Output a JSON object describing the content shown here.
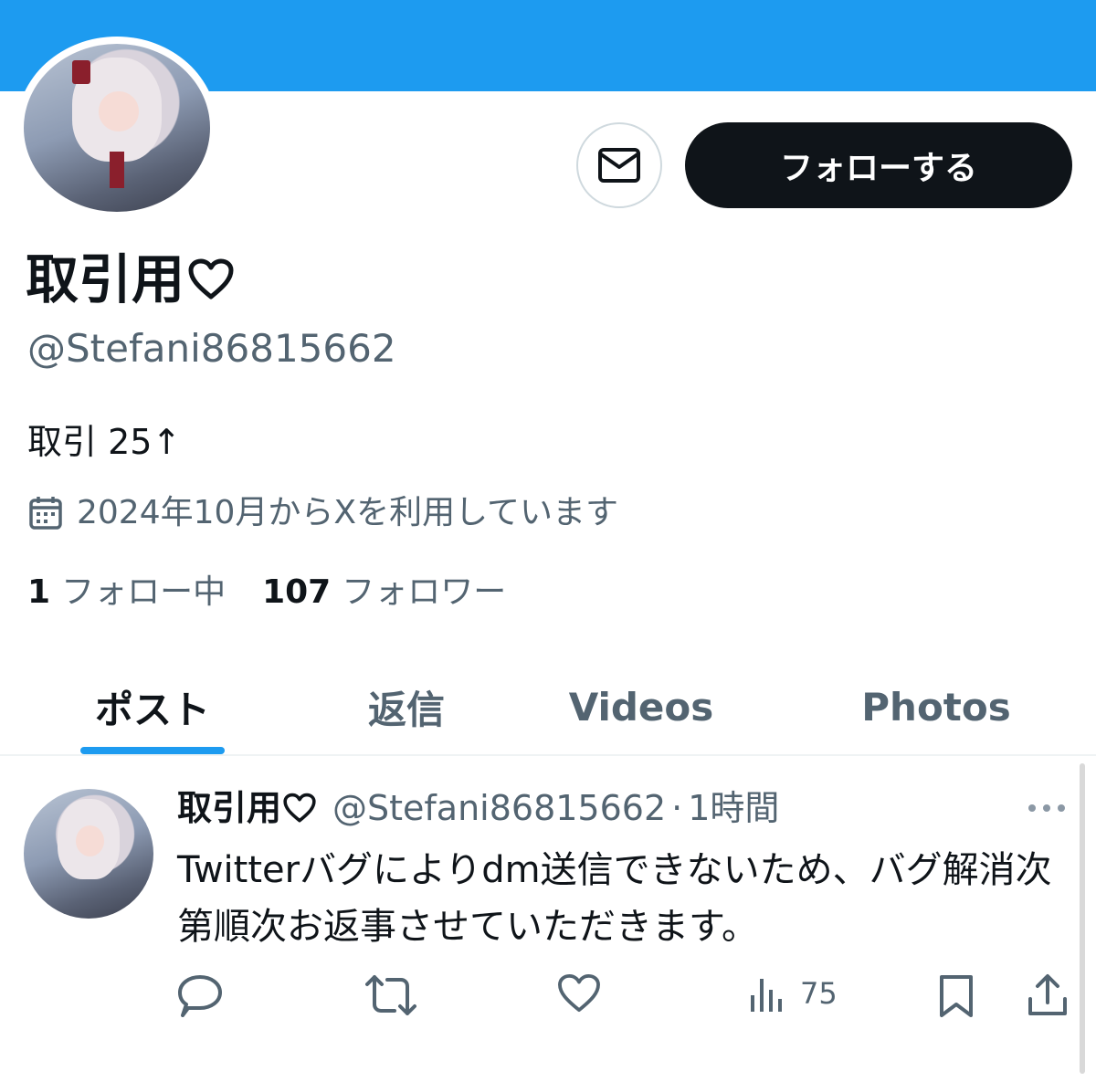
{
  "profile": {
    "display_name": "取引用",
    "handle": "@Stefani86815662",
    "bio": "取引 25↑",
    "joined": "2024年10月からXを利用しています",
    "following_count": "1",
    "following_label": "フォロー中",
    "followers_count": "107",
    "followers_label": "フォロワー",
    "follow_label": "フォローする"
  },
  "tabs": [
    {
      "label": "ポスト"
    },
    {
      "label": "返信"
    },
    {
      "label": "Videos"
    },
    {
      "label": "Photos"
    }
  ],
  "post": {
    "name": "取引用",
    "handle": "@Stefani86815662",
    "separator": "·",
    "time": "1時間",
    "text": "Twitterバグによりdm送信できないため、バグ解消次第順次お返事させていただきます。",
    "views": "75"
  },
  "colors": {
    "banner": "#1d9bf0",
    "accent": "#1d9bf0",
    "text": "#0f1419",
    "secondary": "#536471"
  },
  "icons": [
    "mail-icon",
    "heart-icon",
    "calendar-icon",
    "more-icon",
    "reply-icon",
    "repost-icon",
    "like-icon",
    "views-icon",
    "bookmark-icon",
    "share-icon"
  ]
}
